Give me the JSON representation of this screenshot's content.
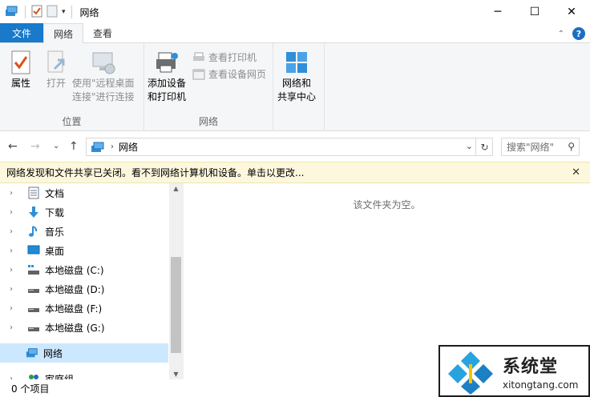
{
  "window": {
    "title": "网络",
    "minimize": "─",
    "maximize": "☐",
    "close": "✕"
  },
  "ribbon_tabs": {
    "file": "文件",
    "network": "网络",
    "view": "查看"
  },
  "ribbon": {
    "location_group": {
      "label": "位置",
      "properties": "属性",
      "open": "打开",
      "remote_line1": "使用\"远程桌面",
      "remote_line2": "连接\"进行连接"
    },
    "network_group": {
      "label": "网络",
      "add_line1": "添加设备",
      "add_line2": "和打印机",
      "view_printers": "查看打印机",
      "view_device_webpage": "查看设备网页"
    },
    "sharing_center": {
      "line1": "网络和",
      "line2": "共享中心"
    }
  },
  "address": {
    "path": "网络",
    "search_placeholder": "搜索\"网络\""
  },
  "infobar": {
    "message": "网络发现和文件共享已关闭。看不到网络计算机和设备。单击以更改..."
  },
  "nav": {
    "items": [
      {
        "label": "文档",
        "icon": "document-icon"
      },
      {
        "label": "下载",
        "icon": "download-icon"
      },
      {
        "label": "音乐",
        "icon": "music-icon"
      },
      {
        "label": "桌面",
        "icon": "desktop-icon"
      },
      {
        "label": "本地磁盘 (C:)",
        "icon": "system-drive-icon"
      },
      {
        "label": "本地磁盘 (D:)",
        "icon": "drive-icon"
      },
      {
        "label": "本地磁盘 (F:)",
        "icon": "drive-icon"
      },
      {
        "label": "本地磁盘 (G:)",
        "icon": "drive-icon"
      },
      {
        "label": "网络",
        "icon": "network-icon"
      },
      {
        "label": "家庭组",
        "icon": "homegroup-icon"
      }
    ]
  },
  "content": {
    "empty_message": "该文件夹为空。"
  },
  "status": {
    "item_count": "0 个项目"
  },
  "watermark": {
    "brand_cn": "系统堂",
    "brand_en": "xitongtang.com"
  },
  "colors": {
    "file_tab": "#1979ca",
    "selection": "#cce8ff",
    "infobar": "#fcf7dd"
  }
}
